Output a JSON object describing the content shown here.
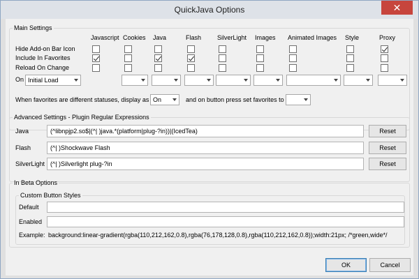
{
  "window": {
    "title": "QuickJava Options",
    "close_glyph": "✕"
  },
  "main": {
    "legend": "Main Settings",
    "columns": [
      "Javascript",
      "Cookies",
      "Java",
      "Flash",
      "SilverLight",
      "Images",
      "Animated Images",
      "Style",
      "Proxy"
    ],
    "rows": [
      {
        "label": "Hide Add-on Bar Icon",
        "checked": [
          false,
          false,
          false,
          false,
          false,
          false,
          false,
          false,
          true
        ]
      },
      {
        "label": "Include In Favorites",
        "checked": [
          true,
          false,
          true,
          true,
          false,
          false,
          false,
          false,
          false
        ]
      },
      {
        "label": "Reload On Change",
        "checked": [
          false,
          false,
          false,
          false,
          false,
          false,
          false,
          false,
          false
        ]
      }
    ],
    "on_label": "On",
    "on_values": [
      "Initial Load",
      "",
      "",
      "",
      "",
      "",
      "",
      "",
      ""
    ],
    "favorites_label": "When favorites are different statuses, display as",
    "favorites_value": "On",
    "press_label": "and on button press set favorites to",
    "press_value": ""
  },
  "advanced": {
    "legend": "Advanced Settings - Plugin Regular Expressions",
    "reset_label": "Reset",
    "rows": [
      {
        "label": "Java",
        "value": "(^libnpjp2.so$|(^| )java.*(platform|plug-?in))|(IcedTea)"
      },
      {
        "label": "Flash",
        "value": "(^| )Shockwave Flash"
      },
      {
        "label": "SilverLight",
        "value": "(^| )Silverlight plug-?in"
      }
    ]
  },
  "beta": {
    "legend": "In Beta Options",
    "custom_legend": "Custom Button Styles",
    "default_label": "Default",
    "default_value": "",
    "enabled_label": "Enabled",
    "enabled_value": "",
    "example_label": "Example:",
    "example_text": "background:linear-gradient(rgba(110,212,162,0.8),rgba(76,178,128,0.8),rgba(110,212,162,0.8));width:21px; /*green,wide*/"
  },
  "footer": {
    "ok_label": "OK",
    "cancel_label": "Cancel"
  }
}
